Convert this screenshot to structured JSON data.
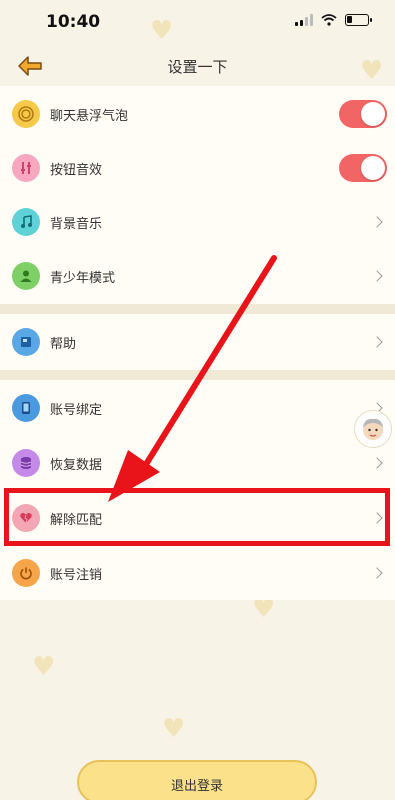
{
  "status_bar": {
    "time": "10:40"
  },
  "nav": {
    "title": "设置一下"
  },
  "settings_group_1": [
    {
      "label": "聊天悬浮气泡",
      "control": "toggle",
      "on": true,
      "icon": "bubble-icon",
      "color": "#f6c94a"
    },
    {
      "label": "按钮音效",
      "control": "toggle",
      "on": true,
      "icon": "sound-effect-icon",
      "color": "#f7a8c0"
    },
    {
      "label": "背景音乐",
      "control": "chevron",
      "icon": "music-note-icon",
      "color": "#5fd2d8"
    },
    {
      "label": "青少年模式",
      "control": "chevron",
      "icon": "teen-person-icon",
      "color": "#7ed066"
    }
  ],
  "settings_group_2": [
    {
      "label": "帮助",
      "control": "chevron",
      "icon": "help-book-icon",
      "color": "#5aa7e6"
    }
  ],
  "settings_group_3": [
    {
      "label": "账号绑定",
      "control": "chevron",
      "icon": "phone-bind-icon",
      "color": "#4a9ae0"
    },
    {
      "label": "恢复数据",
      "control": "chevron",
      "icon": "database-icon",
      "color": "#c58ae8"
    },
    {
      "label": "解除匹配",
      "control": "chevron",
      "icon": "broken-heart-icon",
      "color": "#f3a7b5"
    },
    {
      "label": "账号注销",
      "control": "chevron",
      "icon": "power-icon",
      "color": "#f6a54a"
    }
  ],
  "logout": {
    "label": "退出登录"
  },
  "colors": {
    "toggle_on": "#f26565",
    "highlight": "#e8141a",
    "background": "#f7f3e6"
  }
}
